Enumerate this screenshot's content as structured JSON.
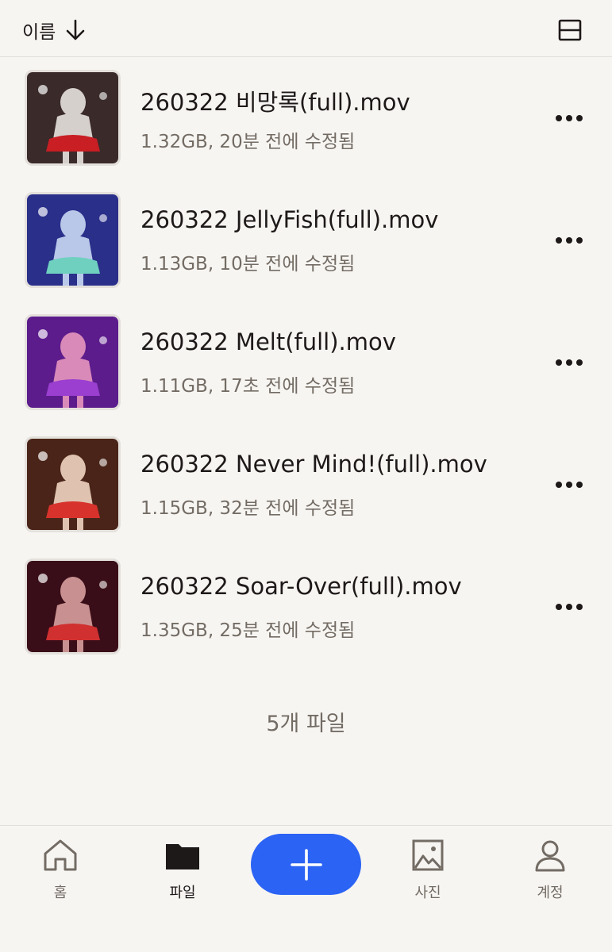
{
  "header": {
    "sort_label": "이름",
    "sort_icon": "arrow-down-icon",
    "layout_icon": "layout-toggle-icon"
  },
  "files": [
    {
      "name": "260322 비망록(full).mov",
      "meta": "1.32GB, 20분 전에 수정됨",
      "thumb_colors": [
        "#3a2a2a",
        "#d6d0cc",
        "#c81e24"
      ]
    },
    {
      "name": "260322 JellyFish(full).mov",
      "meta": "1.13GB, 10분 전에 수정됨",
      "thumb_colors": [
        "#2a2f8a",
        "#b9c7e8",
        "#6fd0c0"
      ]
    },
    {
      "name": "260322 Melt(full).mov",
      "meta": "1.11GB, 17초 전에 수정됨",
      "thumb_colors": [
        "#5c1c8c",
        "#d98ab8",
        "#9a3fd0"
      ]
    },
    {
      "name": "260322 Never Mind!(full).mov",
      "meta": "1.15GB, 32분 전에 수정됨",
      "thumb_colors": [
        "#4a2418",
        "#e0c2b0",
        "#d8322c"
      ]
    },
    {
      "name": "260322 Soar-Over(full).mov",
      "meta": "1.35GB, 25분 전에 수정됨",
      "thumb_colors": [
        "#3a0e18",
        "#c89090",
        "#d03030"
      ]
    }
  ],
  "file_count": "5개 파일",
  "nav": {
    "home": {
      "label": "홈",
      "icon": "home-icon"
    },
    "files": {
      "label": "파일",
      "icon": "folder-icon"
    },
    "add": {
      "icon": "plus-icon",
      "color": "#2b63f4"
    },
    "photos": {
      "label": "사진",
      "icon": "photo-icon"
    },
    "account": {
      "label": "계정",
      "icon": "person-icon"
    }
  },
  "colors": {
    "background": "#f7f5f2",
    "text_primary": "#1e1919",
    "text_secondary": "#736c64",
    "accent": "#2b63f4"
  }
}
